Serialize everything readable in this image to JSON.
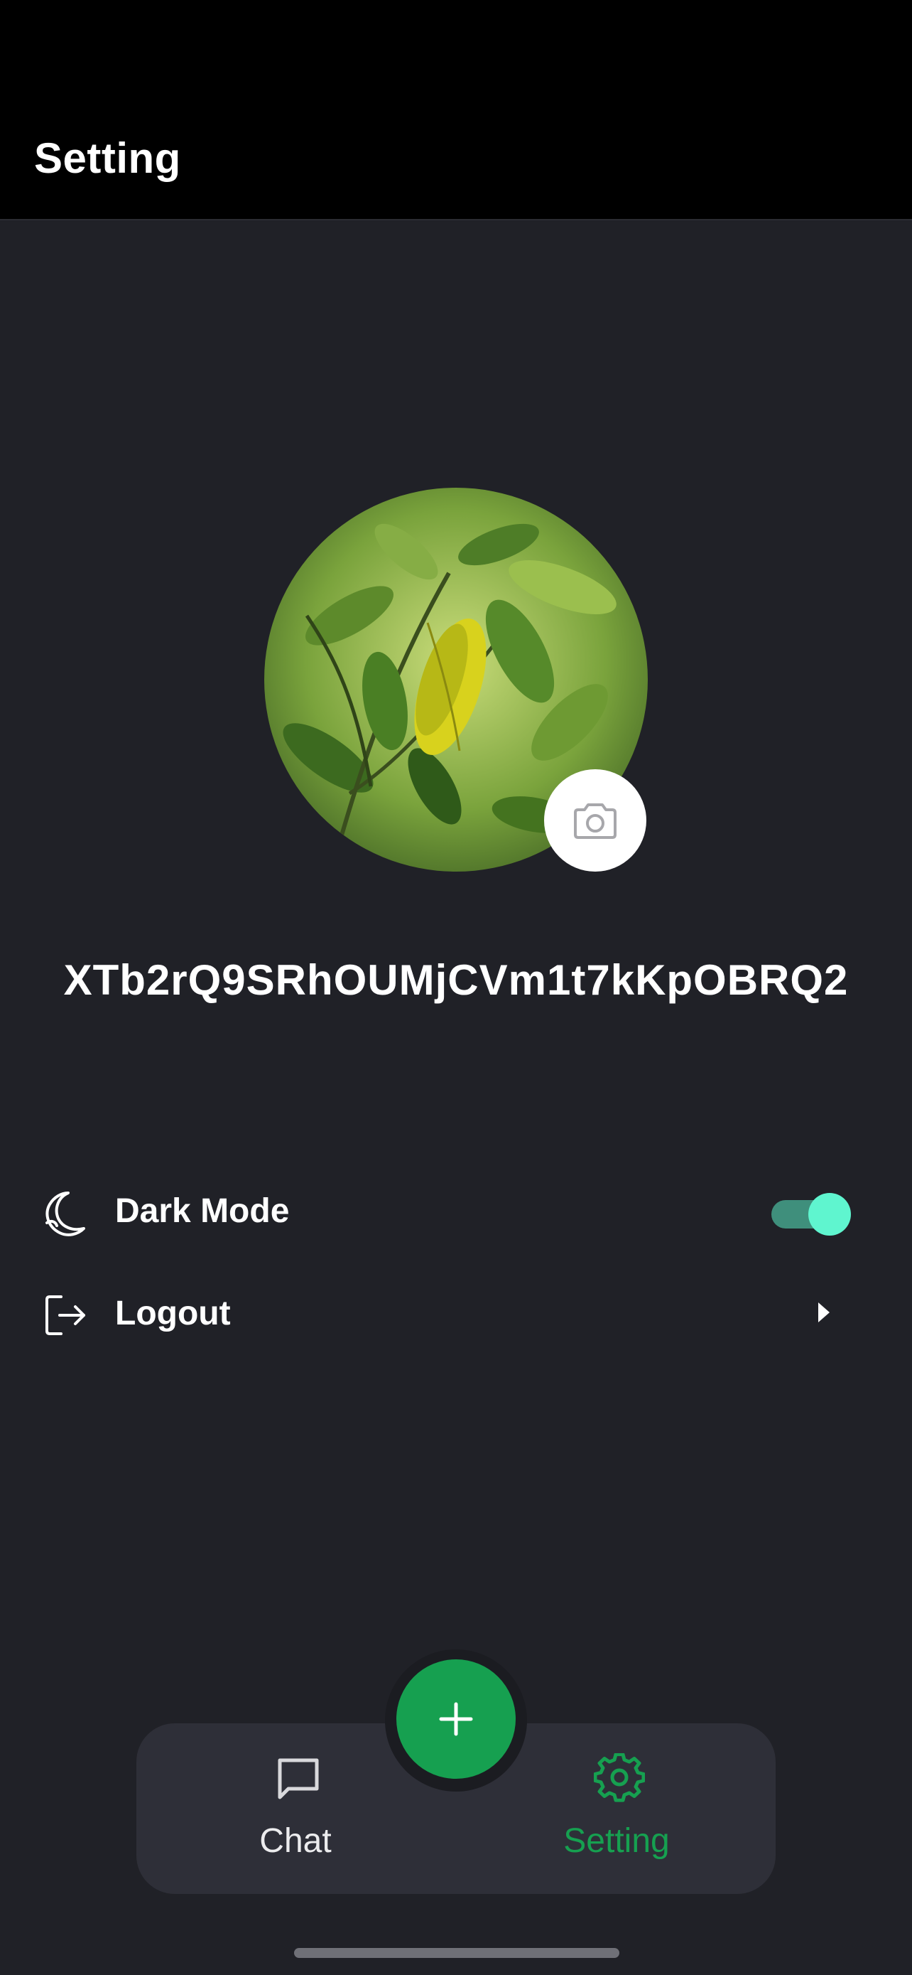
{
  "header": {
    "title": "Setting"
  },
  "profile": {
    "username": "XTb2rQ9SRhOUMjCVm1t7kKpOBRQ2",
    "avatar_icon": "leaf-photo",
    "camera_icon": "camera-icon"
  },
  "settings": {
    "items": [
      {
        "label": "Dark Mode",
        "icon": "moon-icon",
        "control": "toggle",
        "value": true
      },
      {
        "label": "Logout",
        "icon": "logout-icon",
        "control": "chevron-right-icon"
      }
    ]
  },
  "tabbar": {
    "fab_icon": "plus-icon",
    "tabs": [
      {
        "label": "Chat",
        "icon": "chat-icon",
        "active": false
      },
      {
        "label": "Setting",
        "icon": "gear-icon",
        "active": true
      }
    ]
  },
  "colors": {
    "background": "#202127",
    "header": "#000000",
    "accent": "#16a050",
    "active_tab": "#16a050",
    "toggle_knob": "#5ff5cf",
    "toggle_track": "#3f8f7c",
    "tabbar": "#2e2f38"
  }
}
